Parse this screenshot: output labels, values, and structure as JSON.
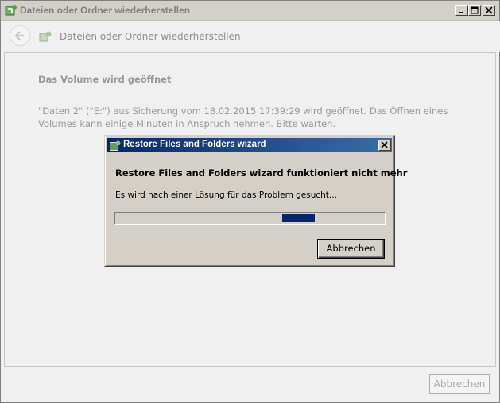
{
  "window": {
    "title": "Dateien oder Ordner wiederherstellen",
    "icon": "restore-app-icon",
    "controls": [
      "minimize-icon",
      "maximize-icon",
      "close-icon"
    ]
  },
  "nav": {
    "back_icon": "back-arrow-icon",
    "title": "Dateien oder Ordner wiederherstellen"
  },
  "content": {
    "heading": "Das Volume wird geöffnet",
    "description": "\"Daten 2\" (\"E:\") aus Sicherung vom 18.02.2015 17:39:29 wird geöffnet. Das Öffnen eines Volumes kann einige Minuten in Anspruch nehmen. Bitte warten."
  },
  "footer": {
    "cancel_label": "Abbrechen"
  },
  "dialog": {
    "title": "Restore Files and Folders wizard",
    "heading": "Restore Files and Folders wizard funktioniert nicht mehr",
    "status": "Es wird nach einer Lösung für das Problem gesucht...",
    "progress_segment": [
      0.62,
      0.74
    ],
    "cancel_label": "Abbrechen",
    "title_bar_color": "#0a246a"
  }
}
